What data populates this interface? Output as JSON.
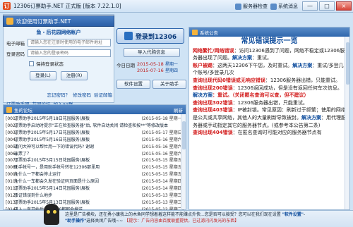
{
  "window": {
    "title": "12306订票助手.NET 正式版 [版本 7.22.1.0]",
    "server_check": "服务器检查",
    "system_msg": "系统消息",
    "minimize": "—",
    "maximize": "□",
    "close": "×"
  },
  "left": {
    "welcome": "欢迎使用订票助手.NET",
    "account_title": "鱼・后花园网络帐户",
    "email_label": "电子邮箱",
    "email_placeholder": "请输入您在注册时使用的电子邮件地址",
    "password_label": "登录密码",
    "password_placeholder": "请输入您的登录密码",
    "remember_label": "保持登录状态",
    "login_btn": "登录(L)",
    "register_btn": "注册(R)",
    "links_row1": [
      "忘记密码？",
      "修改密码",
      "验证邮箱"
    ],
    "links_row2": [
      "订票助手吧",
      "花园论坛",
      "加入qq群"
    ]
  },
  "middle": {
    "login_12306": "登录到12306",
    "import_btn": "导入代购信息",
    "today_label": "今日日期",
    "date1": "2015-05-18",
    "date2": "2015-07-16",
    "weekday1": "星期一",
    "weekday2": "星期四",
    "software_btn": "软件设置",
    "about_btn": "关于助手"
  },
  "announce": {
    "header": "系统公告",
    "title": "常见错误提示一览",
    "lines": [
      {
        "red": "网络繁忙/网络错误",
        "normal": "：访问12306遇到了问题，网络不稳定或12306服务器出现了问题。",
        "blue": "解决方案",
        "tail": "：重试。"
      },
      {
        "red": "账户被踢",
        "normal": "：这两天12306下午您，及时重试。",
        "blue": "解决方案",
        "tail": "：重试/多登几个账号/多登录几次"
      },
      {
        "red": "查询出现代码0错误或无响应错误",
        "normal": "：12306服务器出错，只能重试。",
        "blue": "",
        "tail": ""
      },
      {
        "red": "查询出现200错误",
        "normal": "：12306返回成功，但是没有返回任何车次信息。",
        "blue": "解决方案",
        "tail": "：重试。（关闭匿名查询可以查，但不建议）"
      },
      {
        "red": "查询出现302错误",
        "normal": "：12306服务器出错，只能重试。",
        "blue": "",
        "tail": ""
      },
      {
        "red": "查询出现403错误",
        "normal": "：IP被封锁。常见原因：刷新过于频繁；使用的网络是公共或共享网络，其他人的大量刷新导致被封。",
        "blue": "解决方案",
        "tail": "：用代理服务器或手动指定其它的服务器节点。(或参考本公告第二条)"
      },
      {
        "red": "查询出现404错误",
        "normal": "：在匿名查询时可能对应的服务器节点有",
        "blue": "",
        "tail": ""
      }
    ]
  },
  "forum": {
    "header": "鱼的论坛",
    "refresh": "刷新",
    "items": [
      {
        "num": "[001]",
        "text": "订票助手2015年5月18日花园服务(展板",
        "date": "(2015-05-18 星期一)"
      },
      {
        "num": "[002]",
        "text": "订票助手启动时提示\"正在检查服务器\"后, 软件自动关闭 请检查和按**\"等修改版本",
        "date": ""
      },
      {
        "num": "[003]",
        "text": "订票助手2015年5月17日花园服务(展板",
        "date": "(2015-05-17 星期日)"
      },
      {
        "num": "[004]",
        "text": "订票助手2015年5月16日花园服务(展板",
        "date": "(2015-05-16 星期六)"
      },
      {
        "num": "[005]",
        "text": "请问大神可以帮忙用一下的错误代码? 谢谢",
        "date": "(2015-05-16 星期六)"
      },
      {
        "num": "[006]",
        "text": "出票了？",
        "date": "(2015-05-16 星期六)"
      },
      {
        "num": "[007]",
        "text": "订票助手2015年5月15日花园服务(展板",
        "date": "(2015-05-15 星期五)"
      },
      {
        "num": "[008]",
        "text": "助手帐号一，是用助手帐号转在12306那里用",
        "date": "(2015-05-15 星期五)"
      },
      {
        "num": "[009]",
        "text": "为什么一下都会停止运行",
        "date": "(2015-05-15 星期五)"
      },
      {
        "num": "[010]",
        "text": "为什么一车都会久发在验证码页面是什么原因",
        "date": "(2015-05-14 星期四)"
      },
      {
        "num": "[011]",
        "text": "订票助手2015年5月14日花园服务(展板",
        "date": "(2015-05-14 星期四)"
      },
      {
        "num": "[012]",
        "text": "验证错误到什么地步",
        "date": "(2015-05-13 星期三)"
      },
      {
        "num": "[013]",
        "text": "订票助手2015年5月13日花园服务(展板",
        "date": "(2015-05-13 星期三)"
      },
      {
        "num": "[014]",
        "text": "进入一直开始后，12306都那会搜送",
        "date": "(2015-05-12 星期二)"
      }
    ]
  },
  "bottom": {
    "ad_line1": "这里是广告模块，还在勇小康我上的木鱼同学想着着这样能不能赚点外快...您是否可以接受？您可以在我们现在设置",
    "ad_link": "\"软件设置\"",
    "ad_line1_tail": "-",
    "ad_line2_prefix": "\"助手操作\"",
    "ad_line2": "选择关闭广告哦~~",
    "ad_notice": "【提示：广告内容由百度联盟提供，已过滤闪闪发光的东西】",
    "btn_left": "联系我们",
    "btn_right": "更多"
  }
}
